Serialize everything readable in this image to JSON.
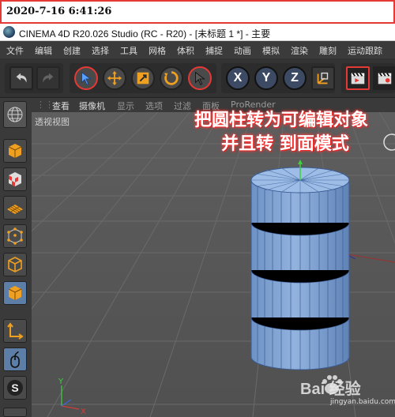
{
  "timestamp": "2020-7-16 6:41:26",
  "window": {
    "title": "CINEMA 4D R20.026 Studio (RC - R20) - [未标题 1 *] - 主要"
  },
  "menu": {
    "items": [
      "文件",
      "编辑",
      "创建",
      "选择",
      "工具",
      "网格",
      "体积",
      "捕捉",
      "动画",
      "模拟",
      "渲染",
      "雕刻",
      "运动跟踪"
    ]
  },
  "toolbar": {
    "axis_x": "X",
    "axis_y": "Y",
    "axis_z": "Z"
  },
  "viewport": {
    "tabs": [
      "查看",
      "摄像机",
      "显示",
      "选项",
      "过滤",
      "面板",
      "ProRender"
    ],
    "active_tabs": [
      "查看",
      "摄像机"
    ],
    "label": "透视视图",
    "axis_labels": {
      "x": "X",
      "y": "Y"
    }
  },
  "annotation": {
    "line1": "把圆柱转为可编辑对象",
    "line2": "并且转 到面模式"
  },
  "watermark": {
    "brand": "Bai 经验",
    "site": "jingyan.baidu.com"
  },
  "colors": {
    "accent_red": "#e53935",
    "active_mode_blue": "#5d7ea6",
    "cylinder_fill": "#7fa2cf",
    "cylinder_edge": "#3a5d96",
    "annotation_glow": "#ff3b3b"
  }
}
